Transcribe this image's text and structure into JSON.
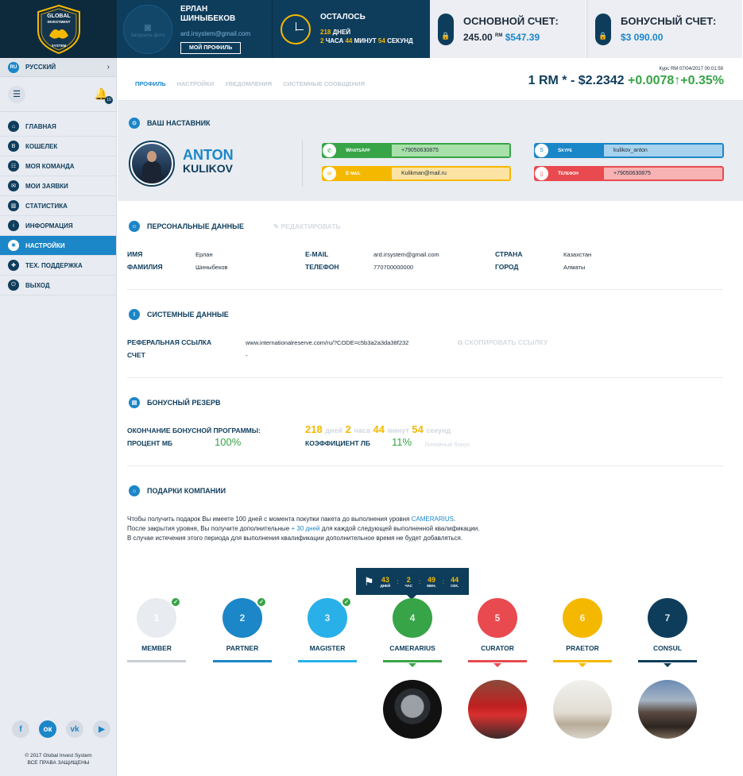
{
  "brand": {
    "logo_line1": "GLOBAL",
    "logo_line2": "INVESTMENT",
    "logo_line3": "SYSTEM"
  },
  "user": {
    "avatar_caption": "Загрузить фото",
    "name_line1": "ЕРЛАН",
    "name_line2": "ШИНЫБЕКОВ",
    "email": "ard.irsystem@gmail.com",
    "profile_button": "МОЙ ПРОФИЛЬ"
  },
  "timer": {
    "title": "ОСТАЛОСЬ",
    "days": "218",
    "days_unit": "ДНЕЙ",
    "hours": "2",
    "hours_unit": "ЧАСА",
    "minutes": "44",
    "minutes_unit": "МИНУТ",
    "seconds": "54",
    "seconds_unit": "СЕКУНД"
  },
  "accounts": {
    "main_title": "ОСНОВНОЙ СЧЕТ:",
    "main_value": "245.00",
    "main_unit": "RM",
    "main_usd": "$547.39",
    "bonus_title": "БОНУСНЫЙ СЧЕТ:",
    "bonus_value": "$3 090.00"
  },
  "sidebar": {
    "lang_code": "RU",
    "lang_label": "РУССКИЙ",
    "notif_count": "10",
    "items": [
      {
        "label": "ГЛАВНАЯ",
        "icon": "home-icon",
        "glyph": "⌂"
      },
      {
        "label": "КОШЕЛЕК",
        "icon": "wallet-icon",
        "glyph": "B"
      },
      {
        "label": "МОЯ КОМАНДА",
        "icon": "team-icon",
        "glyph": "☷"
      },
      {
        "label": "МОИ ЗАЯВКИ",
        "icon": "requests-icon",
        "glyph": "✉"
      },
      {
        "label": "СТАТИСТИКА",
        "icon": "chart-icon",
        "glyph": "▥"
      },
      {
        "label": "ИНФОРМАЦИЯ",
        "icon": "info-icon",
        "glyph": "i"
      },
      {
        "label": "НАСТРОЙКИ",
        "icon": "gear-icon",
        "glyph": "✱"
      },
      {
        "label": "ТЕХ. ПОДДЕРЖКА",
        "icon": "support-icon",
        "glyph": "✚"
      },
      {
        "label": "ВЫХОД",
        "icon": "logout-icon",
        "glyph": "⏻"
      }
    ],
    "active_index": 6,
    "copyright_line1": "© 2017 Global Invest System",
    "copyright_line2": "ВСЕ ПРАВА ЗАЩИЩЕНЫ"
  },
  "tabs": [
    {
      "label": "ПРОФИЛЬ",
      "active": true
    },
    {
      "label": "НАСТРОЙКИ",
      "active": false
    },
    {
      "label": "УВЕДОМЛЕНИЯ",
      "active": false
    },
    {
      "label": "СИСТЕМНЫЕ СООБЩЕНИЯ",
      "active": false
    }
  ],
  "rate": {
    "caption": "Курс RM 07/04/2017 00:01:59",
    "main": "1 RM * - $2.2342",
    "change": "+0.0078↑+0.35%"
  },
  "mentor": {
    "section_title": "ВАШ НАСТАВНИК",
    "first_name": "ANTON",
    "last_name": "KULIKOV",
    "contacts": {
      "whatsapp_label": "WhatsApp",
      "whatsapp_value": "+79050630875",
      "email_label": "E-mail",
      "email_value": "Kulikman@mail.ru",
      "skype_label": "Skype",
      "skype_value": "kulikov_anton",
      "phone_label": "Телефон",
      "phone_value": "+79050630875"
    }
  },
  "personal": {
    "section_title": "ПЕРСОНАЛЬНЫЕ ДАННЫЕ",
    "edit_label": "РЕДАКТИРОВАТЬ",
    "first_name_label": "ИМЯ",
    "first_name": "Ерлан",
    "last_name_label": "ФАМИЛИЯ",
    "last_name": "Шиныбеков",
    "email_label": "E-MAIL",
    "email": "ard.irsystem@gmail.com",
    "phone_label": "ТЕЛЕФОН",
    "phone": "770700000000",
    "country_label": "СТРАНА",
    "country": "Казахстан",
    "city_label": "ГОРОД",
    "city": "Алматы"
  },
  "system": {
    "section_title": "СИСТЕМНЫЕ ДАННЫЕ",
    "ref_label": "РЕФЕРАЛЬНАЯ ССЫЛКА",
    "ref_value": "www.internationalreserve.com/ru/?CODE=c5b3a2a3da38f232",
    "copy_label": "СКОПИРОВАТЬ ССЫЛКУ",
    "account_label": "СЧЕТ",
    "account_value": "-"
  },
  "bonus": {
    "section_title": "БОНУСНЫЙ РЕЗЕРВ",
    "end_label": "ОКОНЧАНИЕ БОНУСНОЙ ПРОГРАММЫ:",
    "days": "218",
    "days_unit": "дней",
    "hours": "2",
    "hours_unit": "часа",
    "minutes": "44",
    "minutes_unit": "минут",
    "seconds": "54",
    "seconds_unit": "секунд",
    "mb_label": "ПРОЦЕНТ МБ",
    "mb_value": "100%",
    "lb_label": "КОЭФФИЦИЕНТ ЛБ",
    "lb_value": "11%",
    "lb_note": "Линейный бонус"
  },
  "gifts": {
    "section_title": "ПОДАРКИ КОМПАНИИ",
    "line1_a": "Чтобы получить подарок Вы имеете 100 дней с момента покупки пакета до выполнения уровня ",
    "line1_b": "CAMERARIUS",
    "line1_c": ".",
    "line2_a": "После закрытия уровня, Вы получите дополнительные ",
    "line2_b": "+ 30 дней",
    "line2_c": " для каждой следующей выполненной квалификации.",
    "line3": "В случае истечения этого периода для выполнения квалификации дополнительное время не будет добавляться.",
    "countdown": {
      "days": "43",
      "days_unit": "ДНЕЙ",
      "hours": "2",
      "hours_unit": "ЧАС",
      "minutes": "49",
      "minutes_unit": "МИН.",
      "seconds": "44",
      "seconds_unit": "СЕК."
    },
    "levels": [
      {
        "name": "MEMBER",
        "num": "1",
        "color": "#e8ebf0",
        "bar": "#c9ced6",
        "done": true
      },
      {
        "name": "PARTNER",
        "num": "2",
        "color": "#1b86c8",
        "bar": "#1b86c8",
        "done": true
      },
      {
        "name": "MAGISTER",
        "num": "3",
        "color": "#29b0e8",
        "bar": "#29b0e8",
        "done": true
      },
      {
        "name": "CAMERARIUS",
        "num": "4",
        "color": "#37a447",
        "bar": "#37a447",
        "done": false
      },
      {
        "name": "CURATOR",
        "num": "5",
        "color": "#e84a4f",
        "bar": "#e84a4f",
        "done": false
      },
      {
        "name": "PRAETOR",
        "num": "6",
        "color": "#f5b800",
        "bar": "#f5b800",
        "done": false
      },
      {
        "name": "CONSUL",
        "num": "7",
        "color": "#0e3d5c",
        "bar": "#0e3d5c",
        "done": false
      }
    ],
    "prizes": [
      "watch-image",
      "car-image",
      "interior-image",
      "house-image"
    ]
  }
}
